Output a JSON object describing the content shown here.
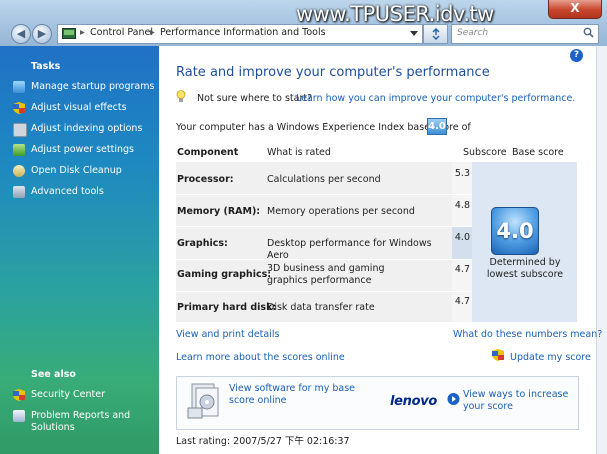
{
  "watermark": "www.TPUSER.idv.tw",
  "window": {
    "close_glyph": "X"
  },
  "nav": {
    "back_glyph": "◀",
    "forward_glyph": "▶"
  },
  "address": {
    "crumb1": "Control Panel",
    "crumb2": "Performance Information and Tools",
    "sep": "▸"
  },
  "search": {
    "placeholder": "Search"
  },
  "sidebar": {
    "tasks_title": "Tasks",
    "items": [
      {
        "label": "Manage startup programs",
        "icon": "startup-icon"
      },
      {
        "label": "Adjust visual effects",
        "icon": "shield-icon"
      },
      {
        "label": "Adjust indexing options",
        "icon": "indexing-icon"
      },
      {
        "label": "Adjust power settings",
        "icon": "power-icon"
      },
      {
        "label": "Open Disk Cleanup",
        "icon": "disk-icon"
      },
      {
        "label": "Advanced tools",
        "icon": "tools-icon"
      }
    ],
    "see_also_title": "See also",
    "see_also": [
      {
        "label": "Security Center"
      },
      {
        "label": "Problem Reports and Solutions"
      }
    ]
  },
  "main": {
    "heading": "Rate and improve your computer's performance",
    "tip_question": "Not sure where to start?",
    "tip_link": "Learn how you can improve your computer's performance.",
    "base_score_text": "Your computer has a Windows Experience Index base score of",
    "base_score": "4.0",
    "columns": {
      "component": "Component",
      "what": "What is rated",
      "subscore": "Subscore",
      "base": "Base score"
    },
    "rows": [
      {
        "component": "Processor:",
        "what": "Calculations per second",
        "subscore": "5.3"
      },
      {
        "component": "Memory (RAM):",
        "what": "Memory operations per second",
        "subscore": "4.8"
      },
      {
        "component": "Graphics:",
        "what": "Desktop performance for Windows Aero",
        "subscore": "4.0"
      },
      {
        "component": "Gaming graphics:",
        "what": "3D business and gaming graphics performance",
        "subscore": "4.7"
      },
      {
        "component": "Primary hard disk:",
        "what": "Disk data transfer rate",
        "subscore": "4.7"
      }
    ],
    "determined_by": "Determined by lowest subscore",
    "view_print": "View and print details",
    "what_numbers": "What do these numbers mean?",
    "learn_more": "Learn more about the scores online",
    "update_score": "Update my score",
    "promo_link": "View software for my base score online",
    "vendor_logo": "lenovo",
    "vendor_link": "View ways to increase your score",
    "last_rating": "Last rating: 2007/5/27 下午 02:16:37"
  }
}
